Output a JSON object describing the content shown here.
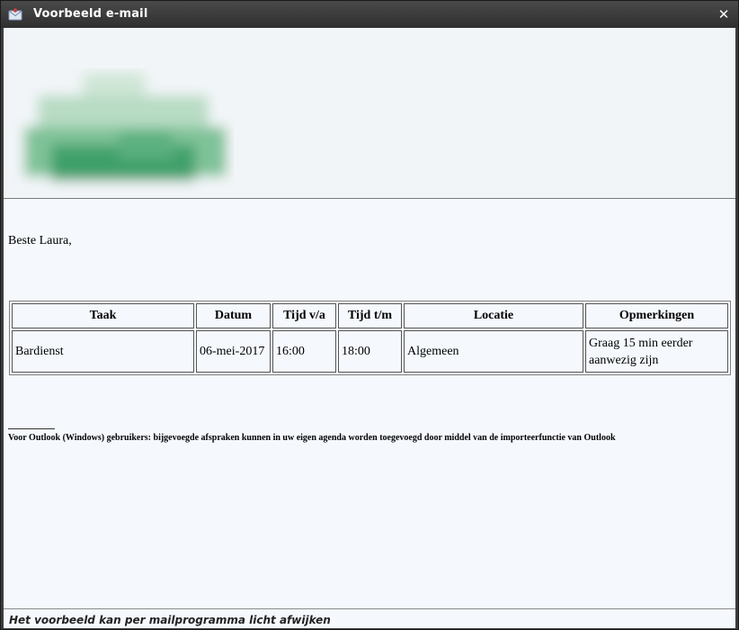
{
  "window": {
    "title": "Voorbeeld e-mail"
  },
  "email": {
    "greeting": "Beste Laura,",
    "table": {
      "headers": [
        "Taak",
        "Datum",
        "Tijd v/a",
        "Tijd t/m",
        "Locatie",
        "Opmerkingen"
      ],
      "rows": [
        [
          "Bardienst",
          "06-mei-2017",
          "16:00",
          "18:00",
          "Algemeen",
          "Graag 15 min eerder aanwezig zijn"
        ]
      ]
    },
    "footnote": "Voor Outlook (Windows) gebruikers: bijgevoegde afspraken kunnen in uw eigen agenda worden toegevoegd door middel van de importeerfunctie van Outlook"
  },
  "status": {
    "text": "Het voorbeeld kan per mailprogramma licht afwijken"
  },
  "icons": {
    "app": "envelope-icon",
    "close": "close-icon",
    "logo": "blurred-logo-image"
  },
  "colors": {
    "titlebar": "#3a3a3a",
    "content_bg": "#f5f9fe",
    "logo_green": "#3fa06a"
  }
}
